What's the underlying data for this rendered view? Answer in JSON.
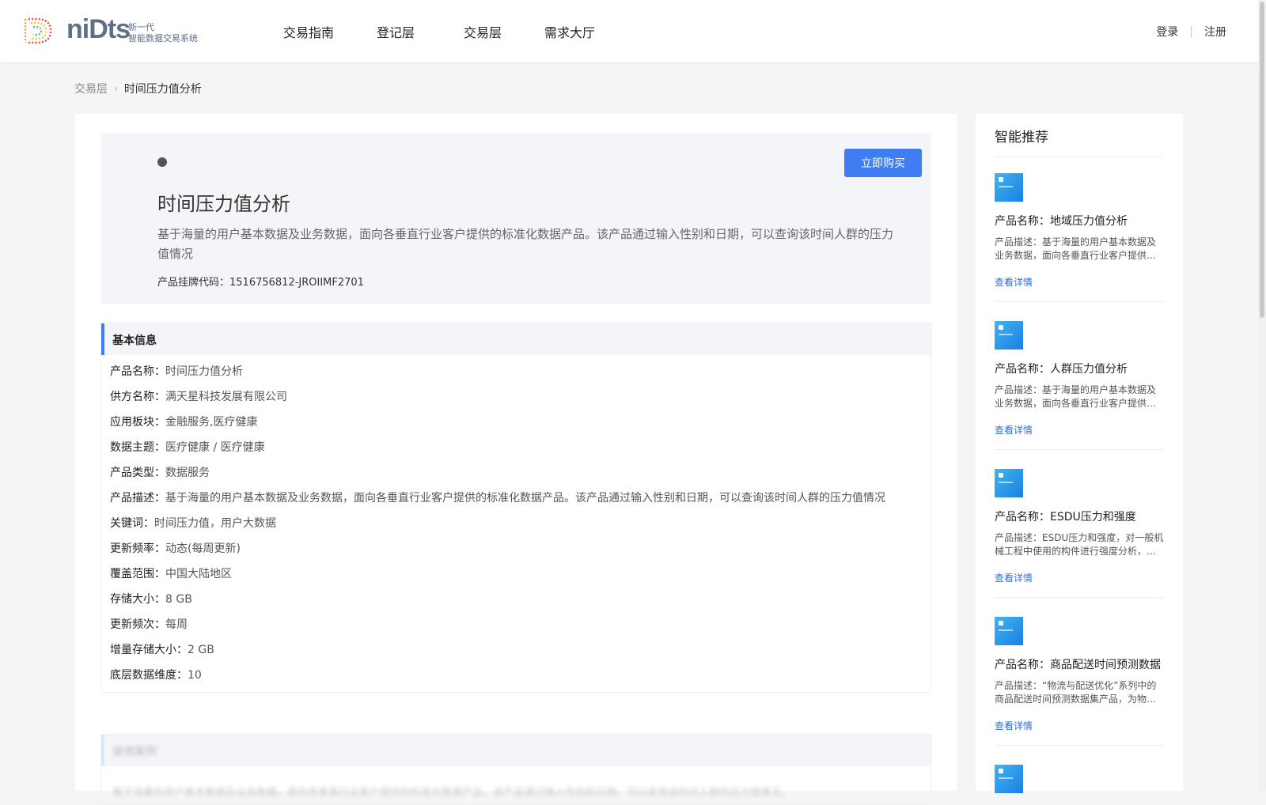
{
  "header": {
    "logo_text": "niDts",
    "logo_sub_1": "新一代",
    "logo_sub_2": "智能数据交易系统",
    "nav": [
      "交易指南",
      "登记层",
      "交易层",
      "需求大厅"
    ],
    "login": "登录",
    "register": "注册",
    "separator": "|"
  },
  "breadcrumb": {
    "parent": "交易层",
    "arrow": "›",
    "current": "时间压力值分析"
  },
  "hero": {
    "title": "时间压力值分析",
    "description": "基于海量的用户基本数据及业务数据，面向各垂直行业客户提供的标准化数据产品。该产品通过输入性别和日期，可以查询该时间人群的压力值情况",
    "code_label": "产品挂牌代码：",
    "code_value": "1516756812-JROIIMF2701",
    "buy_label": "立即购买"
  },
  "basic_info": {
    "title": "基本信息",
    "rows": [
      {
        "key": "产品名称：",
        "value": "时间压力值分析"
      },
      {
        "key": "供方名称：",
        "value": "满天星科技发展有限公司"
      },
      {
        "key": "应用板块：",
        "value": "金融服务,医疗健康"
      },
      {
        "key": "数据主题：",
        "value": "医疗健康 / 医疗健康"
      },
      {
        "key": "产品类型：",
        "value": "数据服务"
      },
      {
        "key": "产品描述：",
        "value": "基于海量的用户基本数据及业务数据，面向各垂直行业客户提供的标准化数据产品。该产品通过输入性别和日期，可以查询该时间人群的压力值情况"
      },
      {
        "key": "关键词：",
        "value": "时间压力值，用户大数据"
      },
      {
        "key": "更新频率：",
        "value": "动态(每周更新)"
      },
      {
        "key": "覆盖范围：",
        "value": "中国大陆地区"
      },
      {
        "key": "存储大小：",
        "value": "8 GB"
      },
      {
        "key": "更新频次：",
        "value": "每周"
      },
      {
        "key": "增量存储大小：",
        "value": "2 GB"
      },
      {
        "key": "底层数据维度：",
        "value": "10"
      }
    ]
  },
  "case_section": {
    "title": "使用案例",
    "text": "基于海量的用户基本数据及业务数据，面向各垂直行业客户提供的标准化数据产品，该产品通过输入性别和日期，可以查询该时间人群的压力值情况。"
  },
  "sidebar": {
    "title": "智能推荐",
    "link_label": "查看详情",
    "items": [
      {
        "name": "产品名称：地域压力值分析",
        "desc": "产品描述：基于海量的用户基本数据及业务数据，面向各垂直行业客户提供的标准化数据产品"
      },
      {
        "name": "产品名称：人群压力值分析",
        "desc": "产品描述：基于海量的用户基本数据及业务数据，面向各垂直行业客户提供的标准化数据产品"
      },
      {
        "name": "产品名称：ESDU压力和强度",
        "desc": "产品描述：ESDU压力和强度，对一般机械工程中使用的构件进行强度分析，提供相关数据"
      },
      {
        "name": "产品名称：商品配送时间预测数据",
        "desc": "产品描述：“物流与配送优化”系列中的商品配送时间预测数据集产品，为物流企业提供参考"
      }
    ]
  },
  "colors": {
    "accent": "#3e7ef2",
    "link": "#2f6fe0",
    "hero_bg": "#f3f5f8"
  }
}
